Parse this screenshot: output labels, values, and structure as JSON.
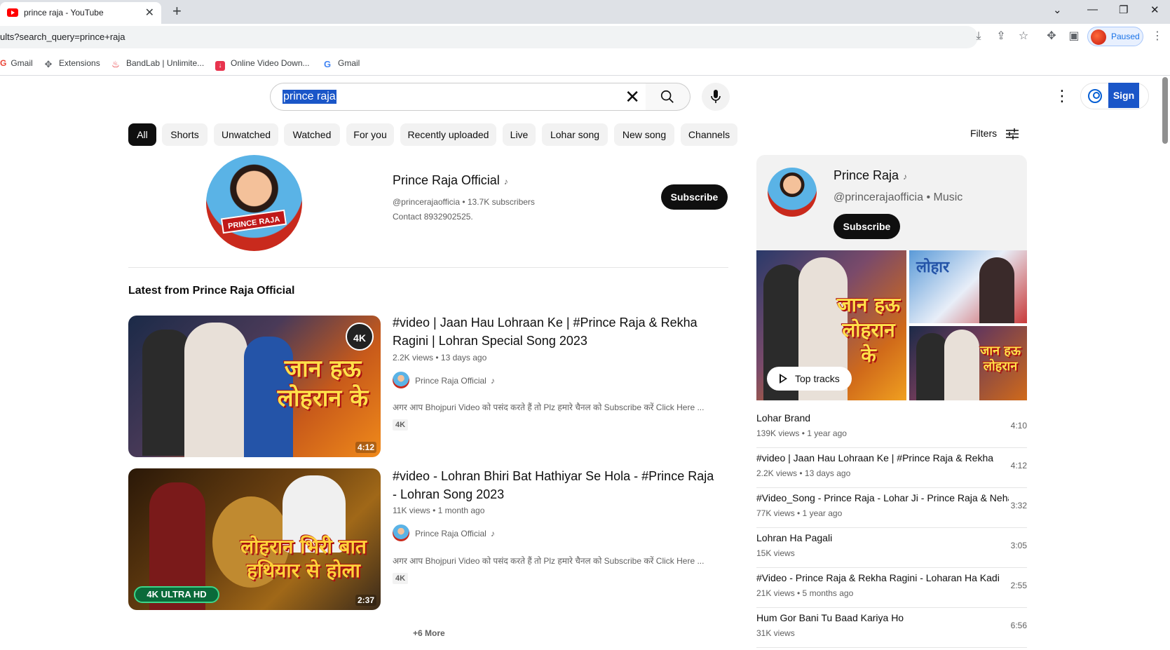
{
  "browser": {
    "tab_title": "prince raja - YouTube",
    "url": "ults?search_query=prince+raja",
    "profile_status": "Paused",
    "bookmarks": [
      {
        "label": "Gmail",
        "icon": "gmail-icon"
      },
      {
        "label": "Extensions",
        "icon": "puzzle-icon"
      },
      {
        "label": "BandLab | Unlimite...",
        "icon": "bandlab-icon"
      },
      {
        "label": "Online Video Down...",
        "icon": "download-icon"
      },
      {
        "label": "Gmail",
        "icon": "google-icon"
      }
    ]
  },
  "search": {
    "query": "prince raja"
  },
  "header": {
    "sign_in_label": "Sign in"
  },
  "chips": [
    "All",
    "Shorts",
    "Unwatched",
    "Watched",
    "For you",
    "Recently uploaded",
    "Live",
    "Lohar song",
    "New song",
    "Channels"
  ],
  "filters_label": "Filters",
  "channel": {
    "name": "Prince Raja Official",
    "handle_subs": "@princerajaofficia • 13.7K subscribers",
    "description": "Contact 8932902525.",
    "subscribe_label": "Subscribe",
    "avatar_text": "PRINCE RAJA"
  },
  "latest_heading": "Latest from Prince Raja Official",
  "videos": [
    {
      "title": "#video | Jaan Hau Lohraan Ke | #Prince Raja & Rekha Ragini | Lohran Special Song 2023",
      "meta": "2.2K views • 13 days ago",
      "channel": "Prince Raja Official",
      "description": "अगर आप Bhojpuri Video को पसंद करते हैं तो Plz हमारे चैनल को Subscribe करें Click Here ...",
      "badge": "4K",
      "duration": "4:12",
      "thumb_text": "जान हऊ लोहरान के"
    },
    {
      "title": "#video - Lohran Bhiri Bat Hathiyar Se Hola - #Prince Raja - Lohran Song 2023",
      "meta": "11K views • 1 month ago",
      "channel": "Prince Raja Official",
      "description": "अगर आप Bhojpuri Video को पसंद करते हैं तो Plz हमारे चैनल को Subscribe करें Click Here ...",
      "badge": "4K",
      "duration": "2:37",
      "thumb_text": "लोहरान भिरी बात हथियार से होला"
    }
  ],
  "more_label": "+6 More",
  "panel": {
    "name": "Prince Raja",
    "handle": "@princerajaofficia • Music",
    "subscribe_label": "Subscribe",
    "top_tracks_label": "Top tracks",
    "tracks": [
      {
        "title": "Lohar Brand",
        "meta": "139K views • 1 year ago",
        "duration": "4:10"
      },
      {
        "title": "#video | Jaan Hau Lohraan Ke | #Prince Raja & Rekha",
        "meta": "2.2K views • 13 days ago",
        "duration": "4:12"
      },
      {
        "title": "#Video_Song - Prince Raja - Lohar Ji - Prince Raja & Neha",
        "meta": "77K views • 1 year ago",
        "duration": "3:32"
      },
      {
        "title": "Lohran Ha Pagali",
        "meta": "15K views",
        "duration": "3:05"
      },
      {
        "title": "#Video - Prince Raja & Rekha Ragini - Loharan Ha Kadi",
        "meta": "21K views • 5 months ago",
        "duration": "2:55"
      },
      {
        "title": "Hum Gor Bani Tu Baad Kariya Ho",
        "meta": "31K views",
        "duration": "6:56"
      }
    ]
  },
  "colors": {
    "accent": "#065fd4",
    "subscribe_bg": "#0f0f0f",
    "chip_bg": "#f2f2f2",
    "youtube_red": "#ff0000"
  }
}
